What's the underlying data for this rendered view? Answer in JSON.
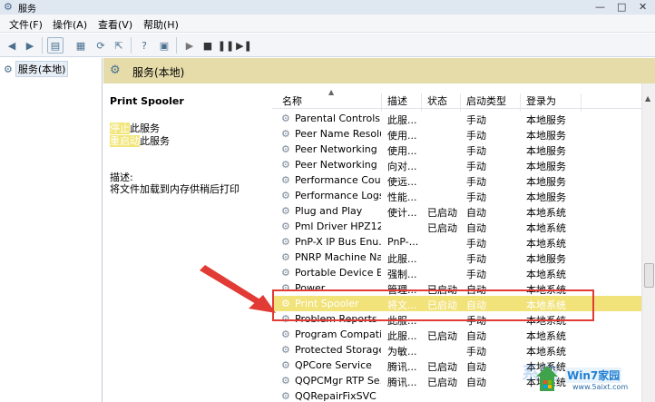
{
  "window": {
    "title": "服务",
    "gear_icon": "gear-icon",
    "controls": [
      "—",
      "□",
      "✕"
    ]
  },
  "menu": [
    "文件(F)",
    "操作(A)",
    "查看(V)",
    "帮助(H)"
  ],
  "toolbar": {
    "icons": [
      "back-icon",
      "forward-icon",
      "show-tree-icon",
      "properties-icon",
      "refresh-icon",
      "export-icon",
      "help-icon",
      "console-icon",
      "play-icon",
      "stop-icon",
      "pause-icon",
      "restart-icon"
    ]
  },
  "tree": {
    "root_label": "服务(本地)"
  },
  "header": {
    "title": "服务(本地)"
  },
  "details": {
    "service_name": "Print Spooler",
    "stop_link": "停止",
    "stop_suffix": "此服务",
    "restart_link": "重启动",
    "restart_suffix": "此服务",
    "desc_label": "描述:",
    "desc_text": "将文件加载到内存供稍后打印"
  },
  "columns": {
    "name": "名称",
    "desc": "描述",
    "status": "状态",
    "startup": "启动类型",
    "logon": "登录为"
  },
  "services": [
    {
      "name": "Parental Controls",
      "desc": "此服...",
      "status": "",
      "startup": "手动",
      "logon": "本地服务"
    },
    {
      "name": "Peer Name Resolu...",
      "desc": "使用...",
      "status": "",
      "startup": "手动",
      "logon": "本地服务"
    },
    {
      "name": "Peer Networking ...",
      "desc": "使用...",
      "status": "",
      "startup": "手动",
      "logon": "本地服务"
    },
    {
      "name": "Peer Networking I...",
      "desc": "向对...",
      "status": "",
      "startup": "手动",
      "logon": "本地服务"
    },
    {
      "name": "Performance Cou...",
      "desc": "使远...",
      "status": "",
      "startup": "手动",
      "logon": "本地服务"
    },
    {
      "name": "Performance Logs...",
      "desc": "性能...",
      "status": "",
      "startup": "手动",
      "logon": "本地服务"
    },
    {
      "name": "Plug and Play",
      "desc": "使计...",
      "status": "已启动",
      "startup": "自动",
      "logon": "本地系统"
    },
    {
      "name": "Pml Driver HPZ12",
      "desc": "",
      "status": "已启动",
      "startup": "自动",
      "logon": "本地系统"
    },
    {
      "name": "PnP-X IP Bus Enu...",
      "desc": "PnP-...",
      "status": "",
      "startup": "手动",
      "logon": "本地系统"
    },
    {
      "name": "PNRP Machine Na...",
      "desc": "此服...",
      "status": "",
      "startup": "手动",
      "logon": "本地服务"
    },
    {
      "name": "Portable Device E...",
      "desc": "强制...",
      "status": "",
      "startup": "手动",
      "logon": "本地系统"
    },
    {
      "name": "Power",
      "desc": "管理...",
      "status": "已启动",
      "startup": "自动",
      "logon": "本地系统"
    },
    {
      "name": "Print Spooler",
      "desc": "将文...",
      "status": "已启动",
      "startup": "自动",
      "logon": "本地系统",
      "selected": true
    },
    {
      "name": "Problem Reports a...",
      "desc": "此服...",
      "status": "",
      "startup": "手动",
      "logon": "本地系统"
    },
    {
      "name": "Program Compati...",
      "desc": "此服...",
      "status": "已启动",
      "startup": "自动",
      "logon": "本地系统"
    },
    {
      "name": "Protected Storage",
      "desc": "为敏...",
      "status": "",
      "startup": "手动",
      "logon": "本地系统"
    },
    {
      "name": "QPCore Service",
      "desc": "腾讯...",
      "status": "已启动",
      "startup": "自动",
      "logon": "本地系统"
    },
    {
      "name": "QQPCMgr RTP Se...",
      "desc": "腾讯...",
      "status": "已启动",
      "startup": "自动",
      "logon": "本地系统"
    },
    {
      "name": "QQRepairFixSVC",
      "desc": "",
      "status": "",
      "startup": "",
      "logon": ""
    }
  ],
  "watermark": {
    "brand": "Win7家园",
    "site": "www.5aixt.com",
    "ghost": "系统"
  },
  "colors": {
    "header_band": "#e6dcaa",
    "selection": "#f1e27a",
    "annotation": "#e23b36"
  }
}
